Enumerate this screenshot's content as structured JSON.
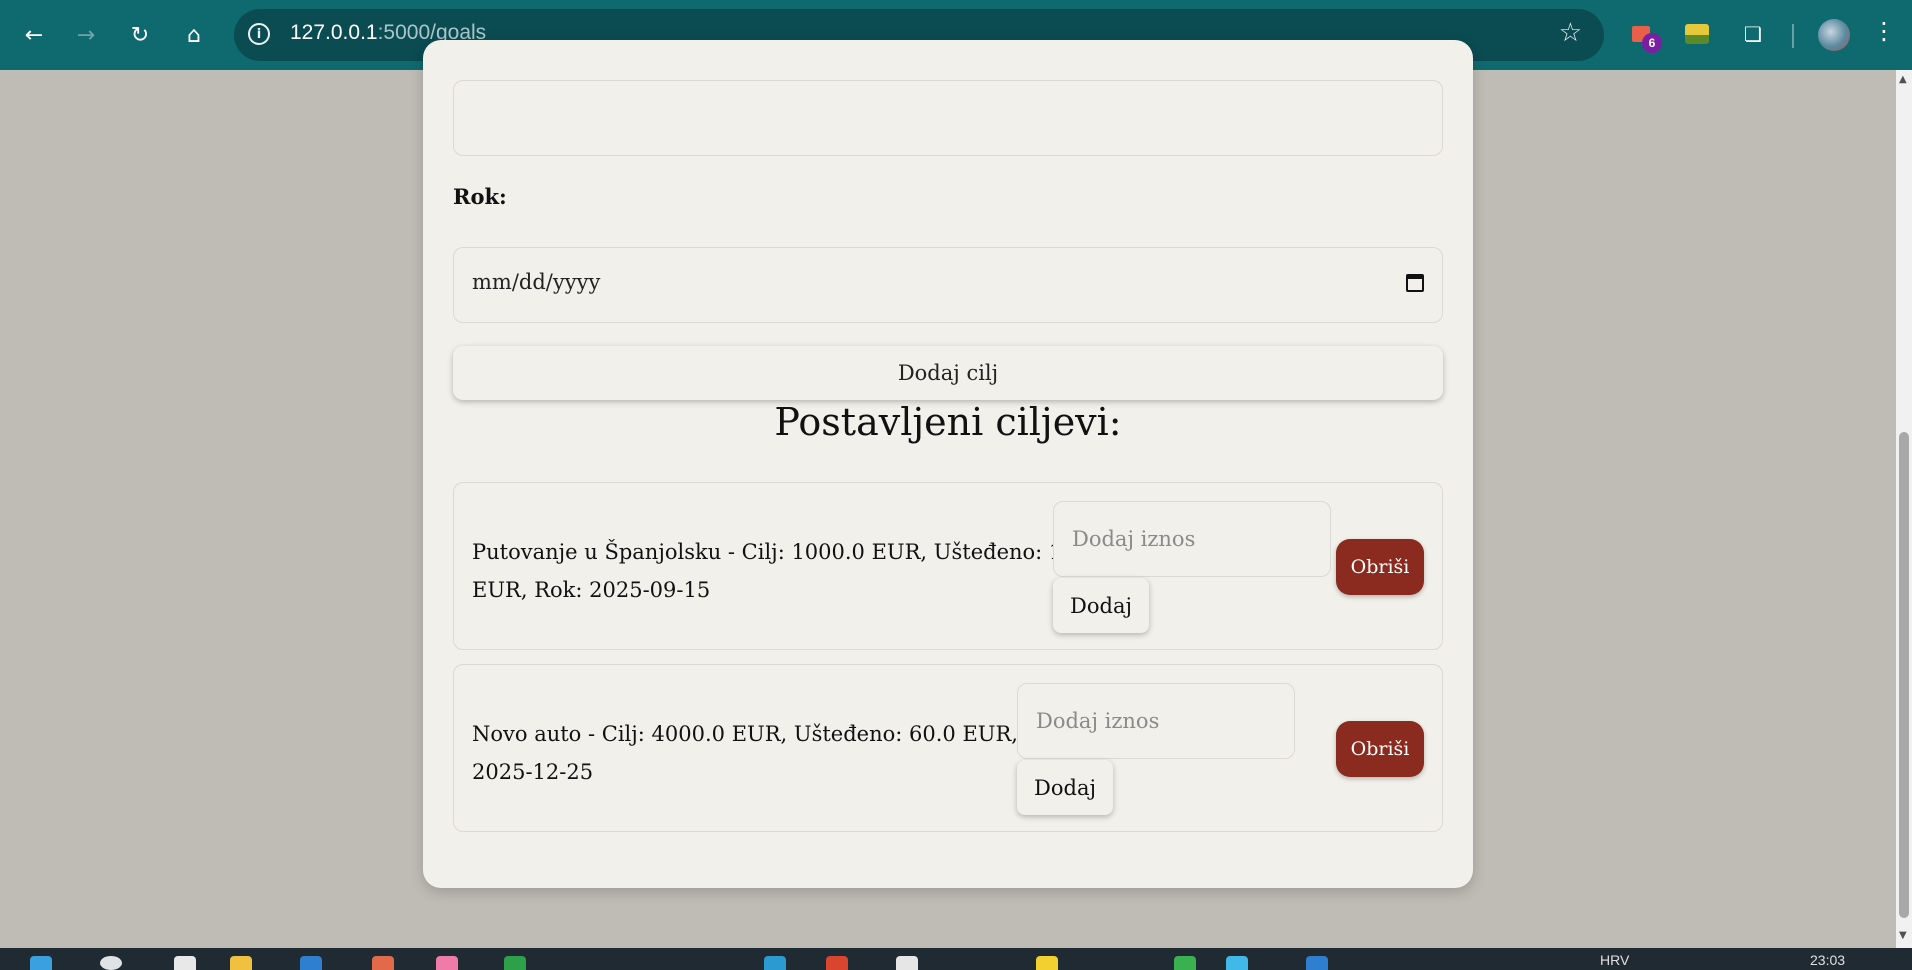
{
  "browser": {
    "url_host": "127.0.0.1",
    "url_rest": ":5000/goals",
    "extension_badge": "6"
  },
  "form": {
    "deadline_label": "Rok:",
    "date_placeholder": "mm/dd/yyyy",
    "add_goal_label": "Dodaj cilj"
  },
  "goals_section": {
    "heading": "Postavljeni ciljevi:",
    "goals": [
      {
        "text": "Putovanje u Španjolsku - Cilj: 1000.0 EUR, Ušteđeno: 155.0",
        "text_line2": "EUR, Rok: 2025-09-15",
        "amount_placeholder": "Dodaj iznos",
        "add_label": "Dodaj",
        "delete_label": "Obriši"
      },
      {
        "text": "Novo auto - Cilj: 4000.0 EUR, Ušteđeno: 60.0 EUR, Rok:",
        "text_line2": "2025-12-25",
        "amount_placeholder": "Dodaj iznos",
        "add_label": "Dodaj",
        "delete_label": "Obriši"
      }
    ]
  },
  "taskbar": {
    "lang": "HRV",
    "time": "23:03"
  },
  "colors": {
    "chrome": "#0f6a6f",
    "page_bg": "#bfbcb5",
    "card_bg": "#f2f0ea",
    "delete_button": "#8b2a1e"
  }
}
